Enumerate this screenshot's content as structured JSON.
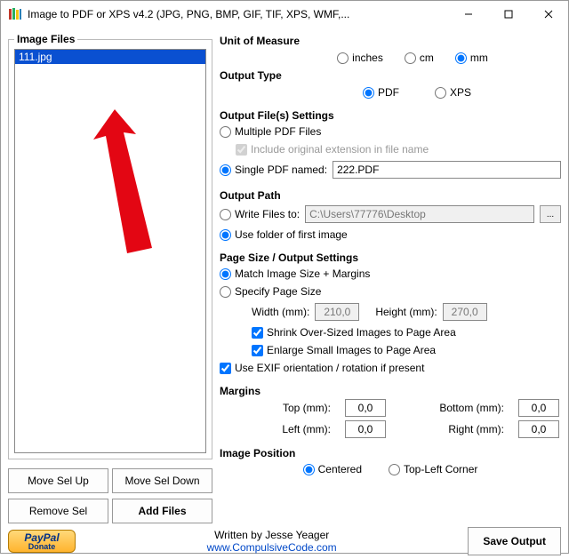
{
  "window": {
    "title": "Image to PDF or XPS  v4.2   (JPG, PNG, BMP, GIF, TIF, XPS, WMF,...",
    "minimize": "—",
    "maximize": "□",
    "close": "×"
  },
  "left": {
    "group_title": "Image Files",
    "items": [
      "111.jpg"
    ],
    "move_up": "Move Sel Up",
    "move_down": "Move Sel Down",
    "remove": "Remove Sel",
    "add": "Add Files"
  },
  "unit": {
    "title": "Unit of Measure",
    "inches": "inches",
    "cm": "cm",
    "mm": "mm"
  },
  "output_type": {
    "title": "Output Type",
    "pdf": "PDF",
    "xps": "XPS"
  },
  "ofs": {
    "title": "Output File(s) Settings",
    "multiple": "Multiple PDF Files",
    "include_ext": "Include original extension in file name",
    "single": "Single PDF named:",
    "single_value": "222.PDF"
  },
  "outpath": {
    "title": "Output Path",
    "write_to": "Write Files to:",
    "write_to_value": "C:\\Users\\77776\\Desktop",
    "browse": "...",
    "use_folder": "Use folder of first image"
  },
  "pagesize": {
    "title": "Page Size / Output Settings",
    "match": "Match Image Size + Margins",
    "specify": "Specify Page Size",
    "width_lbl": "Width (mm):",
    "width_val": "210,0",
    "height_lbl": "Height (mm):",
    "height_val": "270,0",
    "shrink": "Shrink Over-Sized Images to Page Area",
    "enlarge": "Enlarge Small Images to Page Area",
    "exif": "Use EXIF orientation / rotation if present"
  },
  "margins": {
    "title": "Margins",
    "top": "Top (mm):",
    "top_v": "0,0",
    "bottom": "Bottom (mm):",
    "bottom_v": "0,0",
    "left": "Left (mm):",
    "left_v": "0,0",
    "right": "Right (mm):",
    "right_v": "0,0"
  },
  "imgpos": {
    "title": "Image Position",
    "centered": "Centered",
    "topleft": "Top-Left Corner"
  },
  "footer": {
    "paypal_top": "PayPal",
    "paypal_bottom": "Donate",
    "written": "Written by Jesse Yeager",
    "link": "www.CompulsiveCode.com",
    "save": "Save Output"
  }
}
